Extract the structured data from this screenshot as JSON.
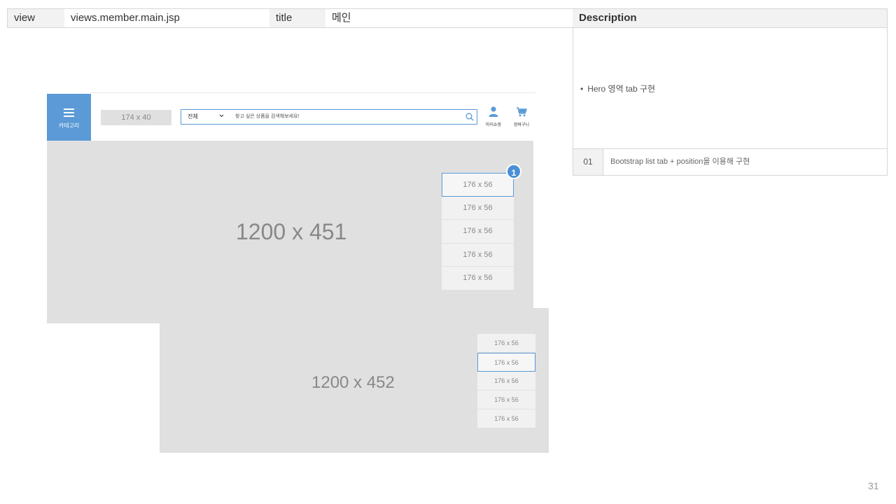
{
  "header": {
    "view_key": "view",
    "view_value": "views.member.main.jsp",
    "title_key": "title",
    "title_value": "메인",
    "description_heading": "Description"
  },
  "description": {
    "bullet": "Hero 영역 tab 구현",
    "rows": [
      {
        "num": "01",
        "text": "Bootstrap list tab + position을 이용해 구현"
      }
    ]
  },
  "wireframe": {
    "category_label": "카테고리",
    "logo_placeholder": "174 x 40",
    "search_select": "전체",
    "search_placeholder": "찾고 싶은 상품을 검색해보세요!",
    "mypage_label": "마이쇼핑",
    "cart_label": "장바구니",
    "accent_color": "#5b9ad6",
    "hero1": {
      "label": "1200 x 451",
      "tabs": [
        "176 x 56",
        "176 x 56",
        "176 x 56",
        "176 x 56",
        "176 x 56"
      ],
      "badge": "1"
    },
    "hero2": {
      "label": "1200 x 452",
      "tabs": [
        "176 x 56",
        "176 x 56",
        "176 x 56",
        "176 x 56",
        "176 x 56"
      ]
    }
  },
  "page_number": "31"
}
